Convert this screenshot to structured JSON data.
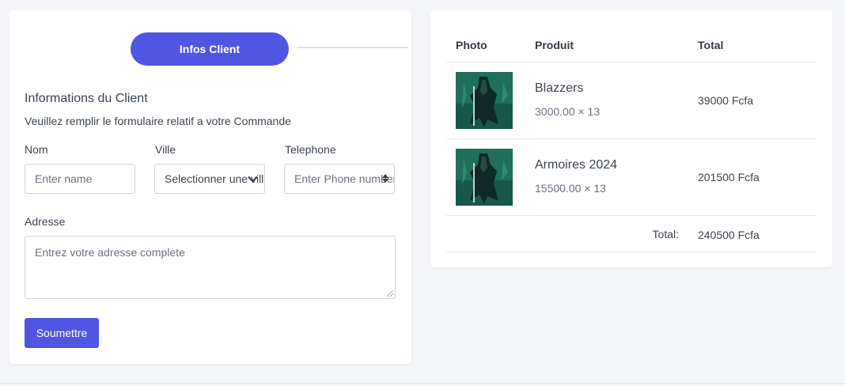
{
  "stepper": {
    "active_step": "Infos Client"
  },
  "form": {
    "title": "Informations du Client",
    "subtitle": "Veuillez remplir le formulaire relatif a votre Commande",
    "nom_label": "Nom",
    "nom_placeholder": "Enter name",
    "ville_label": "Ville",
    "ville_value": "Selectionner une ville",
    "telephone_label": "Telephone",
    "telephone_placeholder": "Enter Phone number",
    "adresse_label": "Adresse",
    "adresse_placeholder": "Entrez votre adresse complete",
    "submit_label": "Soumettre"
  },
  "cart": {
    "columns": [
      "Photo",
      "Produit",
      "Total"
    ],
    "items": [
      {
        "name": "Blazzers",
        "qty": "3000.00 × 13",
        "total": "39000 Fcfa"
      },
      {
        "name": "Armoires 2024",
        "qty": "15500.00 × 13",
        "total": "201500 Fcfa"
      }
    ],
    "total_label": "Total:",
    "total_value": "240500 Fcfa"
  },
  "colors": {
    "accent": "#5156e2",
    "background": "#f4f5f9"
  }
}
